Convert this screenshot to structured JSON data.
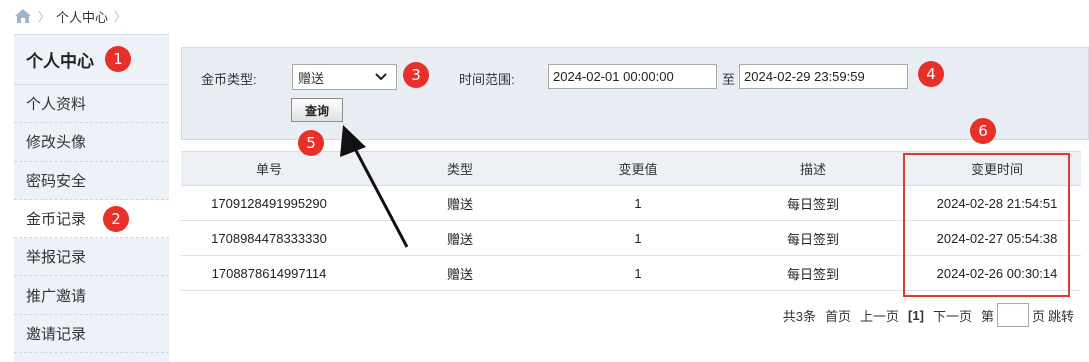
{
  "breadcrumb": {
    "home_icon": "home-icon",
    "current": "个人中心"
  },
  "sidebar": {
    "title": "个人中心",
    "items": [
      {
        "label": "个人资料"
      },
      {
        "label": "修改头像"
      },
      {
        "label": "密码安全"
      },
      {
        "label": "金币记录",
        "active": true
      },
      {
        "label": "举报记录"
      },
      {
        "label": "推广邀请"
      },
      {
        "label": "邀请记录"
      }
    ]
  },
  "filter": {
    "coin_type_label": "金币类型:",
    "coin_type_value": "赠送",
    "time_range_label": "时间范围:",
    "start_time": "2024-02-01 00:00:00",
    "to_label": "至",
    "end_time": "2024-02-29 23:59:59",
    "query_button": "查询"
  },
  "table": {
    "headers": [
      "单号",
      "类型",
      "变更值",
      "描述",
      "变更时间"
    ],
    "rows": [
      [
        "1709128491995290",
        "赠送",
        "1",
        "每日签到",
        "2024-02-28 21:54:51"
      ],
      [
        "1708984478333330",
        "赠送",
        "1",
        "每日签到",
        "2024-02-27 05:54:38"
      ],
      [
        "1708878614997114",
        "赠送",
        "1",
        "每日签到",
        "2024-02-26 00:30:14"
      ]
    ]
  },
  "pager": {
    "total": "共3条",
    "first": "首页",
    "prev": "上一页",
    "current": "[1]",
    "next": "下一页",
    "page_prefix": "第",
    "page_suffix": "页",
    "jump": "跳转"
  },
  "annotations": {
    "badge_1": "1",
    "badge_2": "2",
    "badge_3": "3",
    "badge_4": "4",
    "badge_5": "5",
    "badge_6": "6"
  },
  "colors": {
    "annotation_red": "#e8302a",
    "panel_bg": "#e9eef4",
    "sidebar_bg": "#edf2f8"
  }
}
